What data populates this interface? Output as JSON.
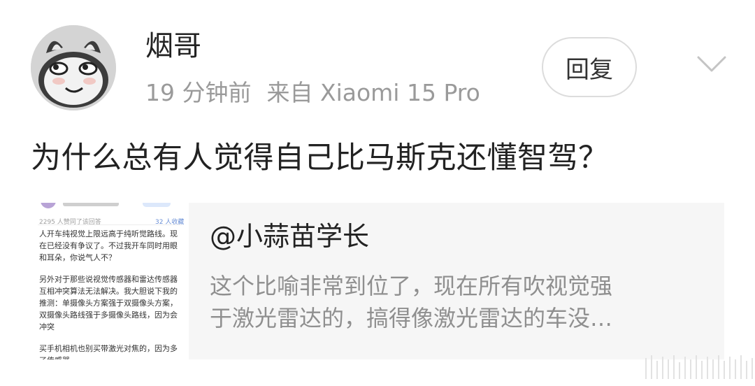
{
  "user": {
    "name": "烟哥",
    "time": "19 分钟前",
    "source": "来自 Xiaomi 15 Pro"
  },
  "actions": {
    "reply_label": "回复",
    "expand_icon": "chevron-down-icon"
  },
  "post": {
    "text": "为什么总有人觉得自己比马斯克还懂智驾？"
  },
  "quote": {
    "title": "@小蒜苗学长",
    "body_line1": "这个比喻非常到位了，现在所有吹视觉强",
    "body_line2": "于激光雷达的，搞得像激光雷达的车没…"
  },
  "thumbnail": {
    "likes_text": "2295 人赞同了该回答",
    "count_text": "32 人收藏",
    "para1": "人开车纯视觉上限远高于纯听觉路线。现在已经没有争议了。不过我开车同时用眼和耳朵，你说气人不？",
    "para2": "另外对于那些说视觉传感器和雷达传感器互相冲突算法无法解决。我大胆说下我的推测：单摄像头方案强于双摄像头方案，双摄像头路线强于多摄像头路线，因为会冲突",
    "para3": "买手机相机也别买带激光对焦的，因为多了传感器"
  },
  "colors": {
    "meta": "#9a9a9a",
    "card_bg": "#f6f6f6",
    "quote_body": "#8f8f8f"
  }
}
